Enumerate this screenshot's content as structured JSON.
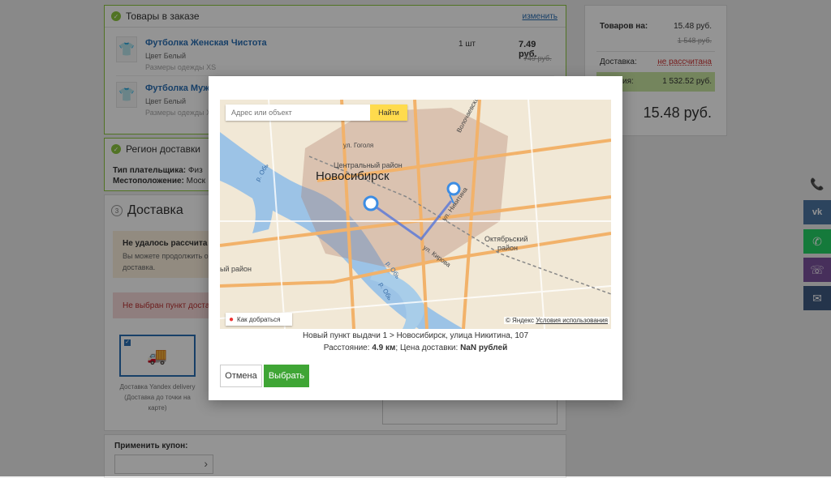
{
  "order": {
    "section_title": "Товары в заказе",
    "change_link": "изменить",
    "items": [
      {
        "name": "Футболка Женская Чистота",
        "color_label": "Цвет",
        "color": "Белый",
        "size_label": "Размеры одежды",
        "size": "XS",
        "qty": "1 шт",
        "price": "7.49 руб.",
        "old_price": "749 руб."
      },
      {
        "name": "Футболка Муж",
        "color_label": "Цвет",
        "color": "Белый",
        "size_label": "Размеры одежды",
        "size": "XS"
      }
    ]
  },
  "region": {
    "section_title": "Регион доставки",
    "payer_label": "Тип плательщика:",
    "payer_value": "Физ",
    "location_label": "Местоположение:",
    "location_value": "Моск"
  },
  "delivery": {
    "number": "3",
    "section_title": "Доставка",
    "error_title": "Не удалось рассчита",
    "error_text_1": "Вы можете продолжить оф",
    "error_text_2": "доставка.",
    "warn_text": "Не выбран пункт доста",
    "option_label_1": "Доставка Yandex delivery",
    "option_label_2": "(Доставка до точки на",
    "option_label_3": "карте)"
  },
  "coupon": {
    "label": "Применить купон:",
    "arrow": "›"
  },
  "summary": {
    "goods_label": "Товаров на:",
    "goods_value": "15.48 руб.",
    "goods_old": "1 548 руб.",
    "delivery_label": "Доставка:",
    "delivery_value": "не рассчитана",
    "economy_label": "кономия:",
    "economy_value": "1 532.52 руб.",
    "total_prefix": "о:",
    "total_value": "15.48 руб."
  },
  "modal": {
    "search_placeholder": "Адрес или объект",
    "search_button": "Найти",
    "map_labels": {
      "city": "Новосибирск",
      "district_central": "Центральный район",
      "district_oct_1": "Октябрьский",
      "district_oct_2": "район",
      "district_left": "ый район",
      "street_gogol": "ул. Гоголя",
      "street_volochaev": "Волочаевская ул.",
      "street_nikitina": "ул. Никитина",
      "street_kirova": "ул. Кирова",
      "river_1": "р. Обь",
      "river_2": "р. Обь",
      "river_3": "р. Обь"
    },
    "route_link": "Как добраться",
    "copyright": "© Яндекс",
    "terms": "Условия использования",
    "point_info": "Новый пункт выдачи 1 > Новосибирск, улица Никитина, 107",
    "distance_label": "Расстояние:",
    "distance_value": "4.9 км",
    "price_label": "Цена доставки:",
    "price_value": "NaN рублей",
    "cancel_button": "Отмена",
    "select_button": "Выбрать"
  },
  "colors": {
    "accent_green": "#3fa535",
    "link_blue": "#2a6fb4",
    "search_yellow": "#ffdb4d",
    "social_phone": "#ededed",
    "social_vk": "#4c75a3",
    "social_whatsapp": "#25d366",
    "social_viber": "#7b519d",
    "social_mail": "#3f5a82"
  },
  "social": [
    {
      "icon": "phone-icon",
      "glyph": "📞"
    },
    {
      "icon": "vk-icon",
      "glyph": "vk"
    },
    {
      "icon": "whatsapp-icon",
      "glyph": "✆"
    },
    {
      "icon": "viber-icon",
      "glyph": "☏"
    },
    {
      "icon": "mail-icon",
      "glyph": "✉"
    }
  ]
}
